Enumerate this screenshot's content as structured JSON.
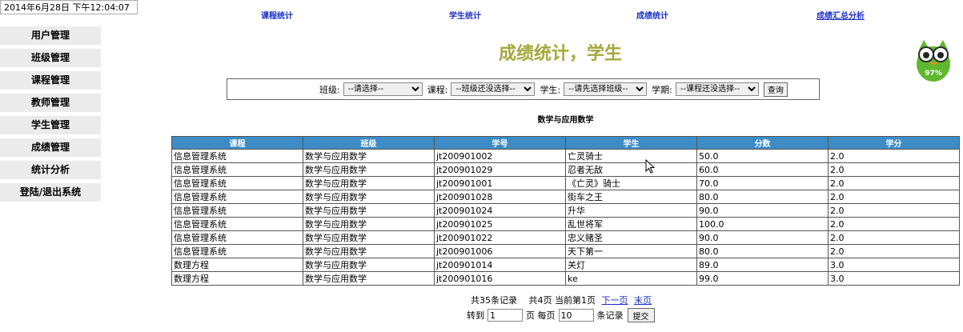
{
  "clock": "2014年6月28日 下午12:04:07",
  "topnav": [
    {
      "label": "课程统计"
    },
    {
      "label": "学生统计"
    },
    {
      "label": "成绩统计"
    },
    {
      "label": "成绩汇总分析"
    }
  ],
  "sidebar": {
    "items": [
      {
        "label": "用户管理"
      },
      {
        "label": "班级管理"
      },
      {
        "label": "课程管理"
      },
      {
        "label": "教师管理"
      },
      {
        "label": "学生管理"
      },
      {
        "label": "成绩管理"
      },
      {
        "label": "统计分析"
      },
      {
        "label": "登陆/退出系统"
      }
    ]
  },
  "page_title": "成绩统计，学生",
  "mascot_badge": "97%",
  "filter": {
    "class_label": "班级:",
    "class_value": "--请选择--",
    "course_label": "课程:",
    "course_value": "--班级还没选择--",
    "student_label": "学生:",
    "student_value": "--请先选择班级--",
    "term_label": "学期:",
    "term_value": "--课程还没选择--",
    "query_label": "查询"
  },
  "caption": "数学与应用数学",
  "table": {
    "headers": [
      "课程",
      "班级",
      "学号",
      "学生",
      "分数",
      "学分"
    ],
    "rows": [
      [
        "信息管理系统",
        "数学与应用数学",
        "jt200901002",
        "亡灵骑士",
        "50.0",
        "2.0"
      ],
      [
        "信息管理系统",
        "数学与应用数学",
        "jt200901029",
        "忍者无敌",
        "60.0",
        "2.0"
      ],
      [
        "信息管理系统",
        "数学与应用数学",
        "jt200901001",
        "《亡灵》骑士",
        "70.0",
        "2.0"
      ],
      [
        "信息管理系统",
        "数学与应用数学",
        "jt200901028",
        "街车之王",
        "80.0",
        "2.0"
      ],
      [
        "信息管理系统",
        "数学与应用数学",
        "jt200901024",
        "升华",
        "90.0",
        "2.0"
      ],
      [
        "信息管理系统",
        "数学与应用数学",
        "jt200901025",
        "乱世将军",
        "100.0",
        "2.0"
      ],
      [
        "信息管理系统",
        "数学与应用数学",
        "jt200901022",
        "忠义赌圣",
        "90.0",
        "2.0"
      ],
      [
        "信息管理系统",
        "数学与应用数学",
        "jt200901006",
        "天下第一",
        "80.0",
        "2.0"
      ],
      [
        "数理方程",
        "数学与应用数学",
        "jt200901014",
        "关灯",
        "89.0",
        "3.0"
      ],
      [
        "数理方程",
        "数学与应用数学",
        "jt200901016",
        "ke",
        "99.0",
        "3.0"
      ]
    ]
  },
  "pager": {
    "summary": "共35条记录　 共4页  当前第1页",
    "next": "下一页",
    "last": "末页",
    "goto_label": "转到",
    "goto_value": "1",
    "per_page_label": "页 每页",
    "per_page_value": "10",
    "records_label": "条记录",
    "submit_label": "提交"
  }
}
